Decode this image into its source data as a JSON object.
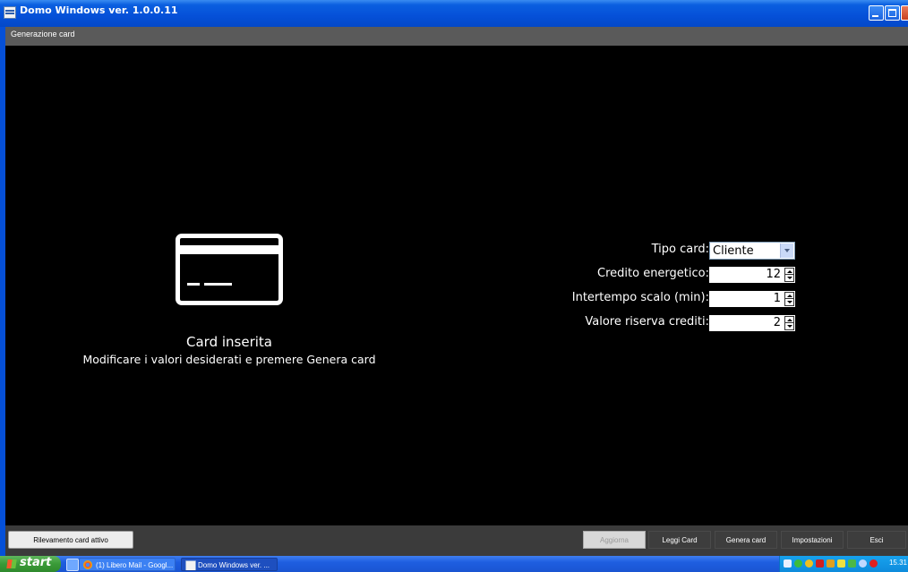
{
  "window": {
    "title": "Domo Windows ver. 1.0.0.11"
  },
  "header": {
    "title": "Generazione card"
  },
  "status": {
    "title": "Card inserita",
    "subtitle": "Modificare i valori desiderati e premere Genera card"
  },
  "form": {
    "tipo_card_label": "Tipo card:",
    "tipo_card_value": "Cliente",
    "credito_label": "Credito energetico:",
    "credito_value": "12",
    "intertempo_label": "Intertempo scalo (min):",
    "intertempo_value": "1",
    "riserva_label": "Valore riserva crediti:",
    "riserva_value": "2"
  },
  "buttons": {
    "rilevamento": "Rilevamento card attivo",
    "aggiorna": "Aggiorna",
    "leggi": "Leggi Card",
    "genera": "Genera card",
    "impostazioni": "Impostazioni",
    "esci": "Esci"
  },
  "taskbar": {
    "start": "start",
    "task1": "(1) Libero Mail - Googl...",
    "task2": "Domo Windows ver. ...",
    "clock": "15.31"
  },
  "colors": {
    "background": "#000000",
    "header": "#5a5a5a",
    "bottom_bar": "#3b3b3b",
    "titlebar": "#0550d8"
  }
}
